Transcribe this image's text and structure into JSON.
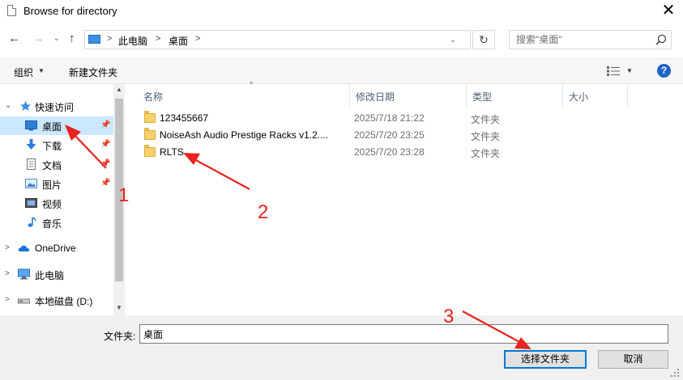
{
  "window": {
    "title": "Browse for directory",
    "close_glyph": "✕"
  },
  "nav": {
    "back_glyph": "←",
    "forward_glyph": "→",
    "recent_glyph": "⌄",
    "up_glyph": "↑"
  },
  "address": {
    "crumbs": [
      "此电脑",
      "桌面"
    ],
    "separator": ">",
    "dropdown_glyph": "⌄",
    "refresh_glyph": "↻"
  },
  "search": {
    "placeholder": "搜索\"桌面\""
  },
  "toolbar": {
    "organize_label": "组织",
    "organize_caret": "▼",
    "new_folder_label": "新建文件夹",
    "view_caret": "▼",
    "help_glyph": "?"
  },
  "sidebar": {
    "items": [
      {
        "label": "快速访问",
        "icon": "star-icon",
        "expander": "⌄"
      },
      {
        "label": "桌面",
        "icon": "desktop-icon",
        "pinned": true,
        "selected": true
      },
      {
        "label": "下载",
        "icon": "download-icon",
        "pinned": true
      },
      {
        "label": "文档",
        "icon": "document-icon",
        "pinned": true
      },
      {
        "label": "图片",
        "icon": "pictures-icon",
        "pinned": true
      },
      {
        "label": "视频",
        "icon": "video-icon"
      },
      {
        "label": "音乐",
        "icon": "music-icon"
      },
      {
        "label": "OneDrive",
        "icon": "cloud-icon",
        "expander": ">"
      },
      {
        "label": "此电脑",
        "icon": "computer-icon",
        "expander": ">"
      },
      {
        "label": "本地磁盘 (D:)",
        "icon": "drive-icon",
        "expander": ">"
      }
    ],
    "pin_glyph": "📌",
    "scroll_up_glyph": "▲",
    "scroll_down_glyph": "▼"
  },
  "filelist": {
    "columns": [
      "名称",
      "修改日期",
      "类型",
      "大小"
    ],
    "sort_glyph": "^",
    "rows": [
      {
        "name": "123455667",
        "date": "2025/7/18 21:22",
        "type": "文件夹"
      },
      {
        "name": "NoiseAsh Audio Prestige Racks v1.2....",
        "date": "2025/7/20 23:25",
        "type": "文件夹"
      },
      {
        "name": "RLTS",
        "date": "2025/7/20 23:28",
        "type": "文件夹"
      }
    ]
  },
  "footer": {
    "folder_label": "文件夹:",
    "folder_value": "桌面",
    "select_button": "选择文件夹",
    "cancel_button": "取消"
  },
  "annotations": {
    "numbers": [
      "1",
      "2",
      "3"
    ],
    "color": "#e8231e"
  },
  "colors": {
    "selection": "#cce8ff",
    "accent": "#0078d7",
    "folder": "#f7d26a"
  }
}
